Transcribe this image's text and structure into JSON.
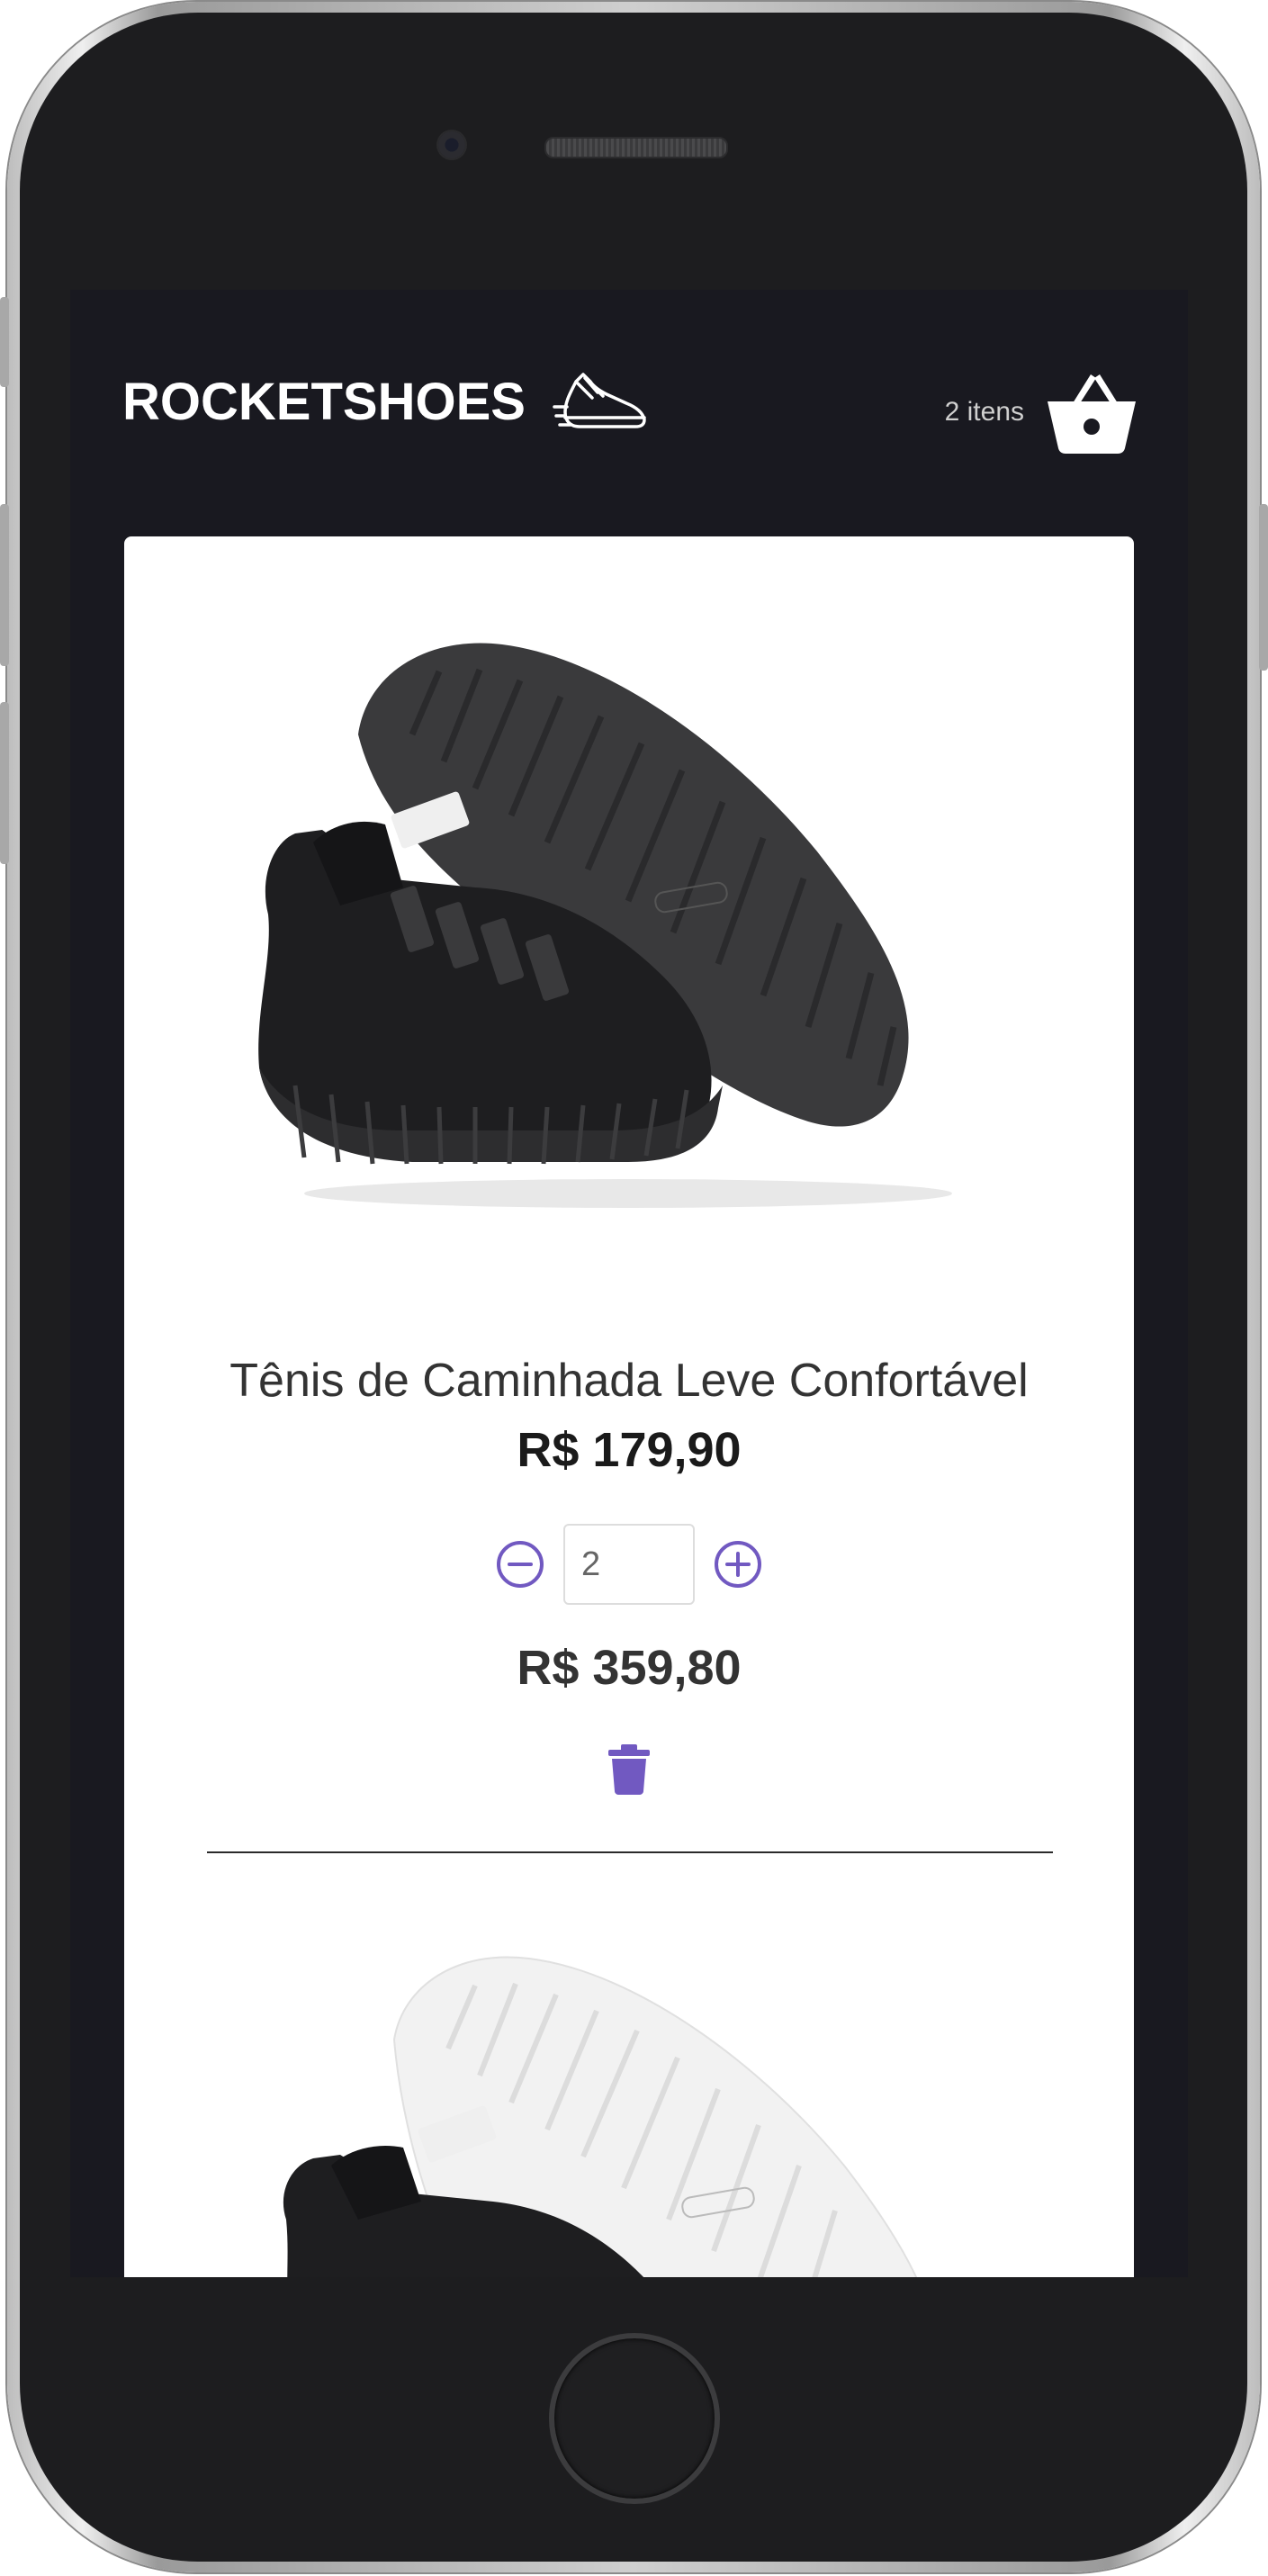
{
  "header": {
    "logo_text": "ROCKETSHOES",
    "logo_icon": "running-shoe-icon",
    "cart_count": "2 itens",
    "cart_icon": "basket-icon"
  },
  "cart": {
    "items": [
      {
        "title": "Tênis de Caminhada Leve Confortável",
        "price": "R$ 179,90",
        "quantity": "2",
        "subtotal": "R$ 359,80",
        "image": "black-sneaker-black-sole"
      },
      {
        "image": "black-sneaker-white-sole"
      }
    ]
  },
  "colors": {
    "background": "#191920",
    "accent": "#7159c1",
    "card": "#ffffff"
  }
}
